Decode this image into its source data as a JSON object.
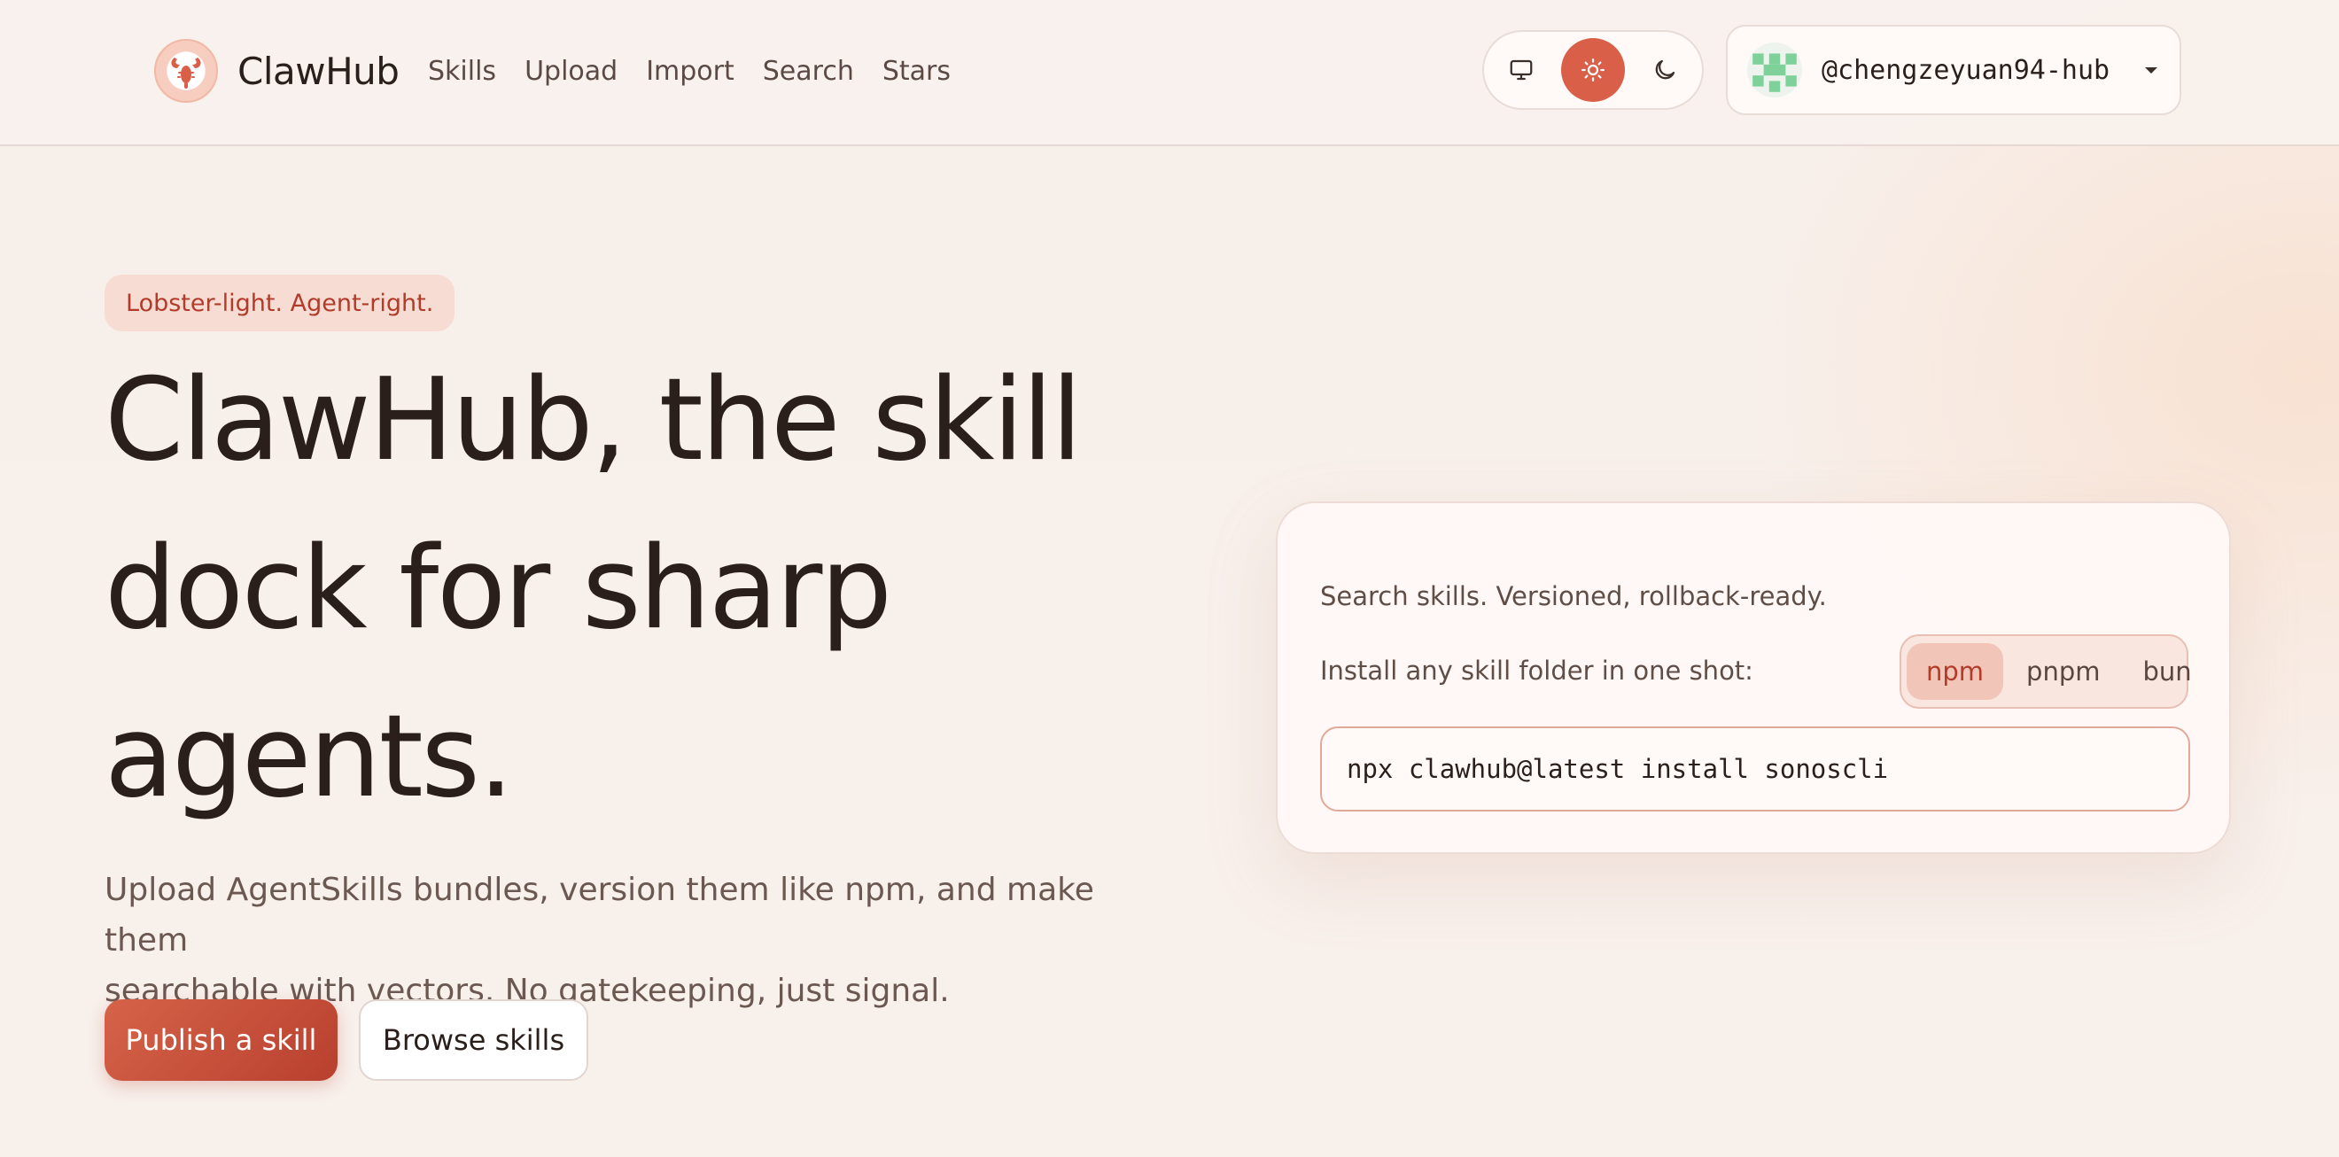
{
  "brand": {
    "name": "ClawHub",
    "logo_icon": "lobster-icon"
  },
  "nav": {
    "items": [
      {
        "label": "Skills"
      },
      {
        "label": "Upload"
      },
      {
        "label": "Import"
      },
      {
        "label": "Search"
      },
      {
        "label": "Stars"
      }
    ]
  },
  "theme": {
    "options": [
      {
        "icon": "monitor-icon",
        "active": false
      },
      {
        "icon": "sun-icon",
        "active": true
      },
      {
        "icon": "moon-icon",
        "active": false
      }
    ],
    "accent": "#d95f48"
  },
  "user": {
    "username": "@chengzeyuan94-hub",
    "avatar_icon": "identicon-avatar",
    "menu_icon": "caret-down-icon"
  },
  "hero": {
    "tagline": "Lobster-light. Agent-right.",
    "title_lines": [
      "ClawHub, the skill",
      "dock for sharp",
      "agents."
    ],
    "subtitle_lines": [
      "Upload AgentSkills bundles, version them like npm, and make them",
      "searchable with vectors. No gatekeeping, just signal."
    ],
    "primary_button": "Publish a skill",
    "secondary_button": "Browse skills"
  },
  "install_card": {
    "lead": "Search skills. Versioned, rollback-ready.",
    "row_label": "Install any skill folder in one shot:",
    "package_managers": [
      {
        "label": "npm",
        "active": true
      },
      {
        "label": "pnpm",
        "active": false
      },
      {
        "label": "bun",
        "active": false
      }
    ],
    "command": "npx clawhub@latest install sonoscli"
  },
  "colors": {
    "background": "#f7efea",
    "accent": "#d95f48",
    "accent_dark": "#b8402e",
    "text": "#2a1f1b",
    "muted": "#6a5851"
  }
}
